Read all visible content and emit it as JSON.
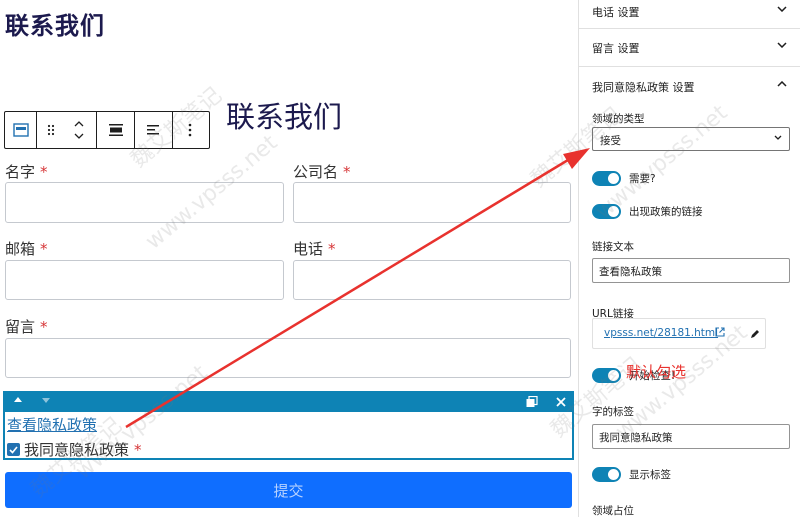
{
  "page": {
    "title": "联系我们"
  },
  "form": {
    "title": "联系我们",
    "fields": [
      {
        "label": "名字",
        "required": "*"
      },
      {
        "label": "公司名",
        "required": "*"
      },
      {
        "label": "邮箱",
        "required": "*"
      },
      {
        "label": "电话",
        "required": "*"
      },
      {
        "label": "留言",
        "required": "*"
      }
    ],
    "consent": {
      "link_text": "查看隐私政策",
      "label": "我同意隐私政策",
      "required": "*",
      "checked": true
    },
    "submit_label": "提交"
  },
  "sidebar": {
    "panels": [
      {
        "title": "电话 设置",
        "expanded": false
      },
      {
        "title": "留言 设置",
        "expanded": false
      },
      {
        "title": "我同意隐私政策 设置",
        "expanded": true
      }
    ],
    "field_type_label": "领域的类型",
    "field_type_value": "接受",
    "required_toggle": {
      "label": "需要?",
      "on": true
    },
    "show_policy_link_toggle": {
      "label": "出现政策的链接",
      "on": true
    },
    "link_text_label": "链接文本",
    "link_text_value": "查看隐私政策",
    "url_label": "URL链接",
    "url_value": "vpsss.net/28181.html",
    "default_checked_toggle": {
      "label": "开始检查!",
      "on": true
    },
    "field_label_label": "字的标签",
    "field_label_value": "我同意隐私政策",
    "show_label_toggle": {
      "label": "显示标签",
      "on": true
    },
    "placeholder_label": "领域占位"
  },
  "annotation": {
    "note": "默认勾选",
    "watermarks": [
      "魏艾斯笔记",
      "www.vpsss.net"
    ],
    "color": "#e8322e"
  },
  "colors": {
    "accent": "#0e83b5",
    "submit": "#0f6eff",
    "link": "#2271b1",
    "required": "#d63638"
  }
}
